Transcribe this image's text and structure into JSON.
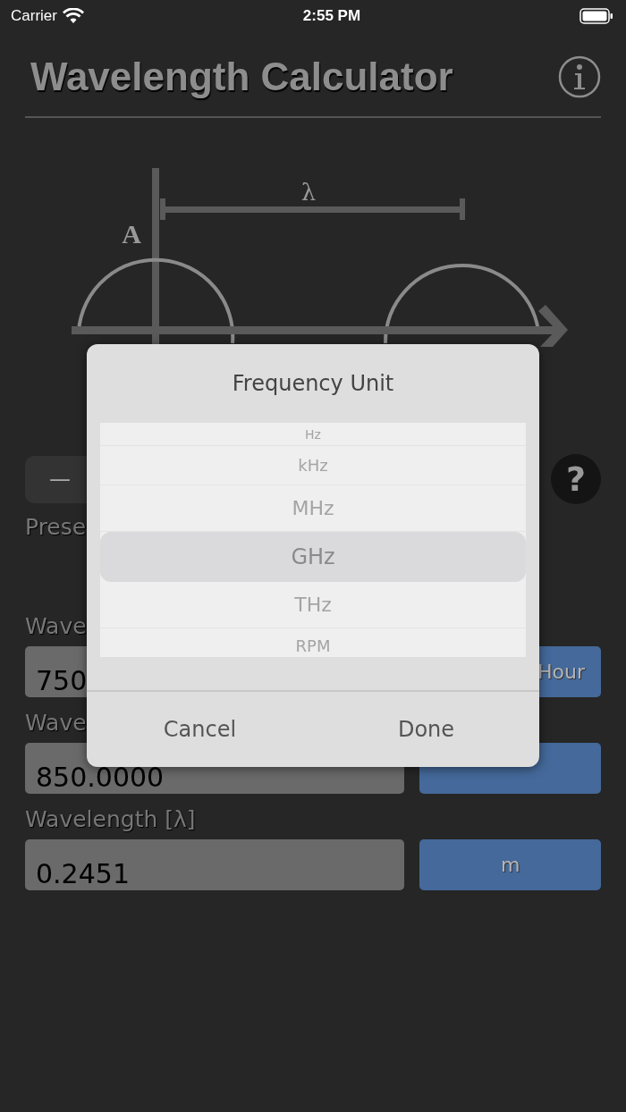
{
  "status_bar": {
    "carrier": "Carrier",
    "time": "2:55 PM"
  },
  "header": {
    "title": "Wavelength Calculator"
  },
  "diagram": {
    "wavelength_label": "λ",
    "amplitude_label": "A"
  },
  "stepper": {
    "minus": "—"
  },
  "help_button": "?",
  "preset_label": "Prese",
  "rows": [
    {
      "kind": "shifted",
      "label": "Wave",
      "value": "750",
      "unit": "Hour"
    },
    {
      "kind": "centered",
      "label": "Wave",
      "value": "850.0000"
    },
    {
      "kind": "centered",
      "label": "Wavelength [λ]",
      "value": "0.2451",
      "unit": "m"
    }
  ],
  "dialog": {
    "title": "Frequency Unit",
    "options": [
      {
        "label": "Hz",
        "selected": false
      },
      {
        "label": "kHz",
        "selected": false
      },
      {
        "label": "MHz",
        "selected": false
      },
      {
        "label": "GHz",
        "selected": true
      },
      {
        "label": "THz",
        "selected": false
      },
      {
        "label": "RPM",
        "selected": false
      }
    ],
    "buttons": [
      "Cancel",
      "Done"
    ]
  }
}
